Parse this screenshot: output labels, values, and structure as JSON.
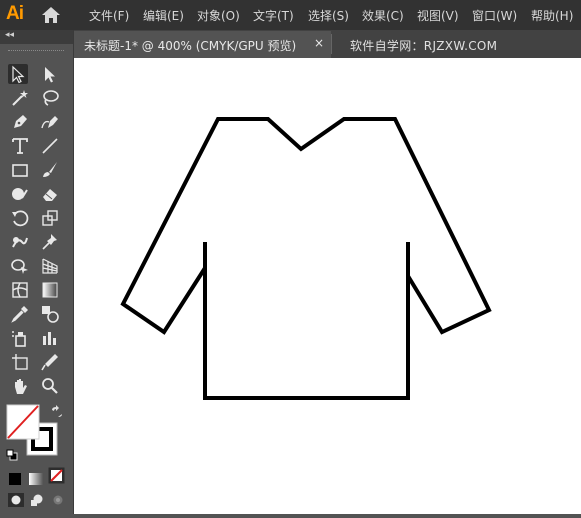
{
  "app": {
    "logo_text": "Ai",
    "logo_color": "#ff9a00"
  },
  "menu": {
    "items": [
      {
        "label": "文件(F)"
      },
      {
        "label": "编辑(E)"
      },
      {
        "label": "对象(O)"
      },
      {
        "label": "文字(T)"
      },
      {
        "label": "选择(S)"
      },
      {
        "label": "效果(C)"
      },
      {
        "label": "视图(V)"
      },
      {
        "label": "窗口(W)"
      },
      {
        "label": "帮助(H)"
      }
    ]
  },
  "document_tab": {
    "title": "未标题-1* @ 400% (CMYK/GPU 预览)",
    "close_glyph": "×"
  },
  "watermark": "软件自学网：RJZXW.COM",
  "toolbar": {
    "collapse_glyph": "◂◂",
    "tools": [
      {
        "name": "selection-tool",
        "icon": "arrow-black-icon",
        "selected": true
      },
      {
        "name": "direct-selection-tool",
        "icon": "arrow-white-icon"
      },
      {
        "name": "magic-wand-tool",
        "icon": "magic-wand-icon"
      },
      {
        "name": "lasso-tool",
        "icon": "lasso-icon"
      },
      {
        "name": "pen-tool",
        "icon": "pen-icon"
      },
      {
        "name": "curvature-tool",
        "icon": "curvature-pen-icon"
      },
      {
        "name": "type-tool",
        "icon": "type-icon"
      },
      {
        "name": "line-tool",
        "icon": "line-segment-icon"
      },
      {
        "name": "rectangle-tool",
        "icon": "rectangle-icon"
      },
      {
        "name": "paintbrush-tool",
        "icon": "paintbrush-icon"
      },
      {
        "name": "shaper-tool",
        "icon": "shaper-icon"
      },
      {
        "name": "eraser-tool",
        "icon": "eraser-icon"
      },
      {
        "name": "rotate-tool",
        "icon": "rotate-icon"
      },
      {
        "name": "scale-tool",
        "icon": "scale-icon"
      },
      {
        "name": "warp-tool",
        "icon": "warp-icon"
      },
      {
        "name": "puppet-warp-tool",
        "icon": "pushpin-icon"
      },
      {
        "name": "shape-builder-tool",
        "icon": "shape-builder-icon"
      },
      {
        "name": "perspective-grid-tool",
        "icon": "perspective-grid-icon"
      },
      {
        "name": "mesh-tool",
        "icon": "mesh-icon"
      },
      {
        "name": "gradient-tool",
        "icon": "gradient-icon"
      },
      {
        "name": "eyedropper-tool",
        "icon": "eyedropper-icon"
      },
      {
        "name": "blend-tool",
        "icon": "blend-icon"
      },
      {
        "name": "symbol-sprayer-tool",
        "icon": "symbol-sprayer-icon"
      },
      {
        "name": "column-graph-tool",
        "icon": "column-graph-icon"
      },
      {
        "name": "artboard-tool",
        "icon": "artboard-icon"
      },
      {
        "name": "slice-tool",
        "icon": "slice-icon"
      },
      {
        "name": "hand-tool",
        "icon": "hand-icon"
      },
      {
        "name": "zoom-tool",
        "icon": "magnifier-icon"
      }
    ]
  },
  "colors": {
    "fill": "none",
    "stroke": "#000000",
    "none_slash": "#e02020",
    "canvas": "#ffffff",
    "ui_dark": "#323232",
    "ui_mid": "#535353"
  }
}
